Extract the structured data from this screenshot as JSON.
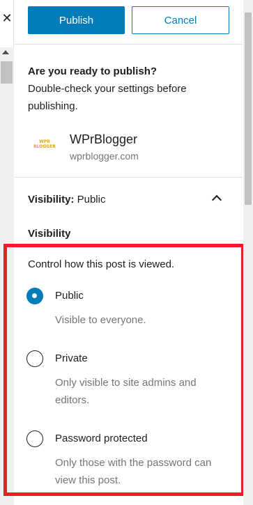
{
  "header": {
    "publish_label": "Publish",
    "cancel_label": "Cancel"
  },
  "intro": {
    "title": "Are you ready to publish?",
    "body": "Double-check your settings before publishing."
  },
  "site": {
    "logo_text": "WPR BLOGGER",
    "name": "WPrBlogger",
    "url": "wprblogger.com"
  },
  "visibility": {
    "toggle_prefix": "Visibility:",
    "toggle_value": "Public",
    "heading": "Visibility",
    "help": "Control how this post is viewed.",
    "options": [
      {
        "label": "Public",
        "description": "Visible to everyone.",
        "checked": true
      },
      {
        "label": "Private",
        "description": "Only visible to site admins and editors.",
        "checked": false
      },
      {
        "label": "Password protected",
        "description": "Only those with the password can view this post.",
        "checked": false
      }
    ]
  },
  "colors": {
    "accent": "#007cba",
    "highlight": "#ee1c24",
    "muted_text": "#757575"
  }
}
